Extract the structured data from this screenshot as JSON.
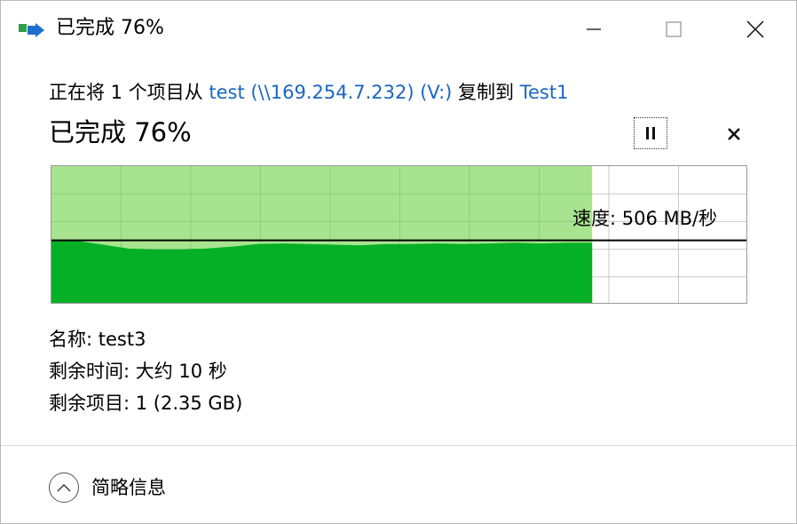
{
  "window": {
    "title": "已完成 76%",
    "icon": "file-copy-icon"
  },
  "titlebar_buttons": {
    "minimize_icon": "minimize-icon",
    "maximize_icon": "maximize-icon",
    "close_icon": "close-icon"
  },
  "copy": {
    "prefix": "正在将 1 个项目从 ",
    "source": "test (\\\\169.254.7.232) (V:)",
    "middle": " 复制到 ",
    "destination": "Test1"
  },
  "progress": {
    "title": "已完成 76%",
    "percent": 76
  },
  "controls": {
    "pause_icon": "pause-icon",
    "cancel_icon": "cancel-icon"
  },
  "graph": {
    "speed_label": "速度: 506 MB/秒",
    "speed_history_relative": [
      1.0,
      0.98,
      0.92,
      0.86,
      0.85,
      0.85,
      0.86,
      0.89,
      0.93,
      0.94,
      0.93,
      0.92,
      0.91,
      0.93,
      0.93,
      0.94,
      0.93,
      0.94,
      0.95,
      0.94,
      0.95,
      0.95
    ],
    "colors": {
      "done_area": "#a8e490",
      "speed_area": "#06b026",
      "grid": "#c9c9c9",
      "current_speed_line": "#000000"
    }
  },
  "details": {
    "name": "名称: test3",
    "time_remaining": "剩余时间: 大约 10 秒",
    "items_remaining": "剩余项目: 1 (2.35 GB)"
  },
  "footer": {
    "toggle_icon": "chevron-up-icon",
    "toggle_label": "简略信息"
  }
}
